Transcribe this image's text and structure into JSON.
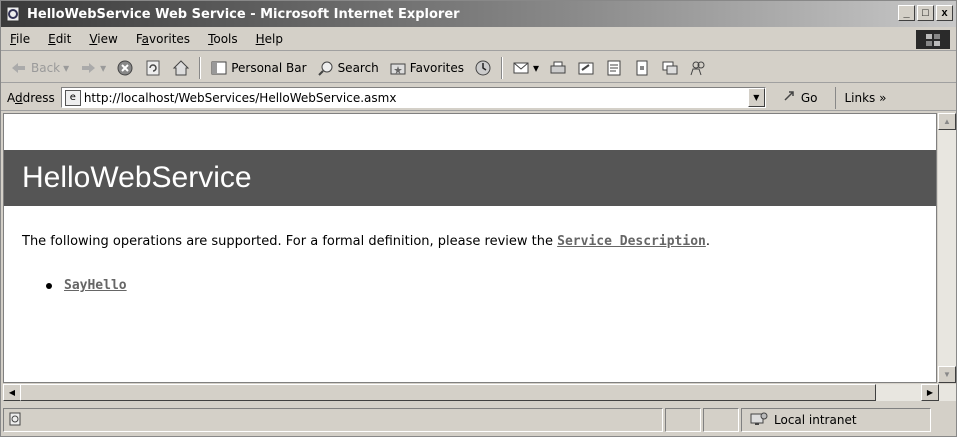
{
  "window": {
    "title": "HelloWebService Web Service - Microsoft Internet Explorer",
    "controls": {
      "minimize": "_",
      "maximize": "□",
      "close": "x"
    }
  },
  "menu": {
    "items": [
      {
        "first": "F",
        "rest": "ile"
      },
      {
        "first": "E",
        "rest": "dit"
      },
      {
        "first": "V",
        "rest": "iew"
      },
      {
        "pre": "F",
        "first": "a",
        "rest": "vorites"
      },
      {
        "first": "T",
        "rest": "ools"
      },
      {
        "first": "H",
        "rest": "elp"
      }
    ]
  },
  "toolbar": {
    "back": "Back",
    "personal_bar": "Personal Bar",
    "search": "Search",
    "favorites": "Favorites"
  },
  "address": {
    "label_pre": "A",
    "label_u": "d",
    "label_post": "dress",
    "url": "http://localhost/WebServices/HelloWebService.asmx",
    "go": "Go",
    "links": "Links »"
  },
  "page": {
    "heading": "HelloWebService",
    "intro": "The following operations are supported. For a formal definition, please review the ",
    "description_link": "Service Description",
    "intro_end": ".",
    "operations": [
      "SayHello"
    ]
  },
  "status": {
    "zone": "Local intranet"
  }
}
